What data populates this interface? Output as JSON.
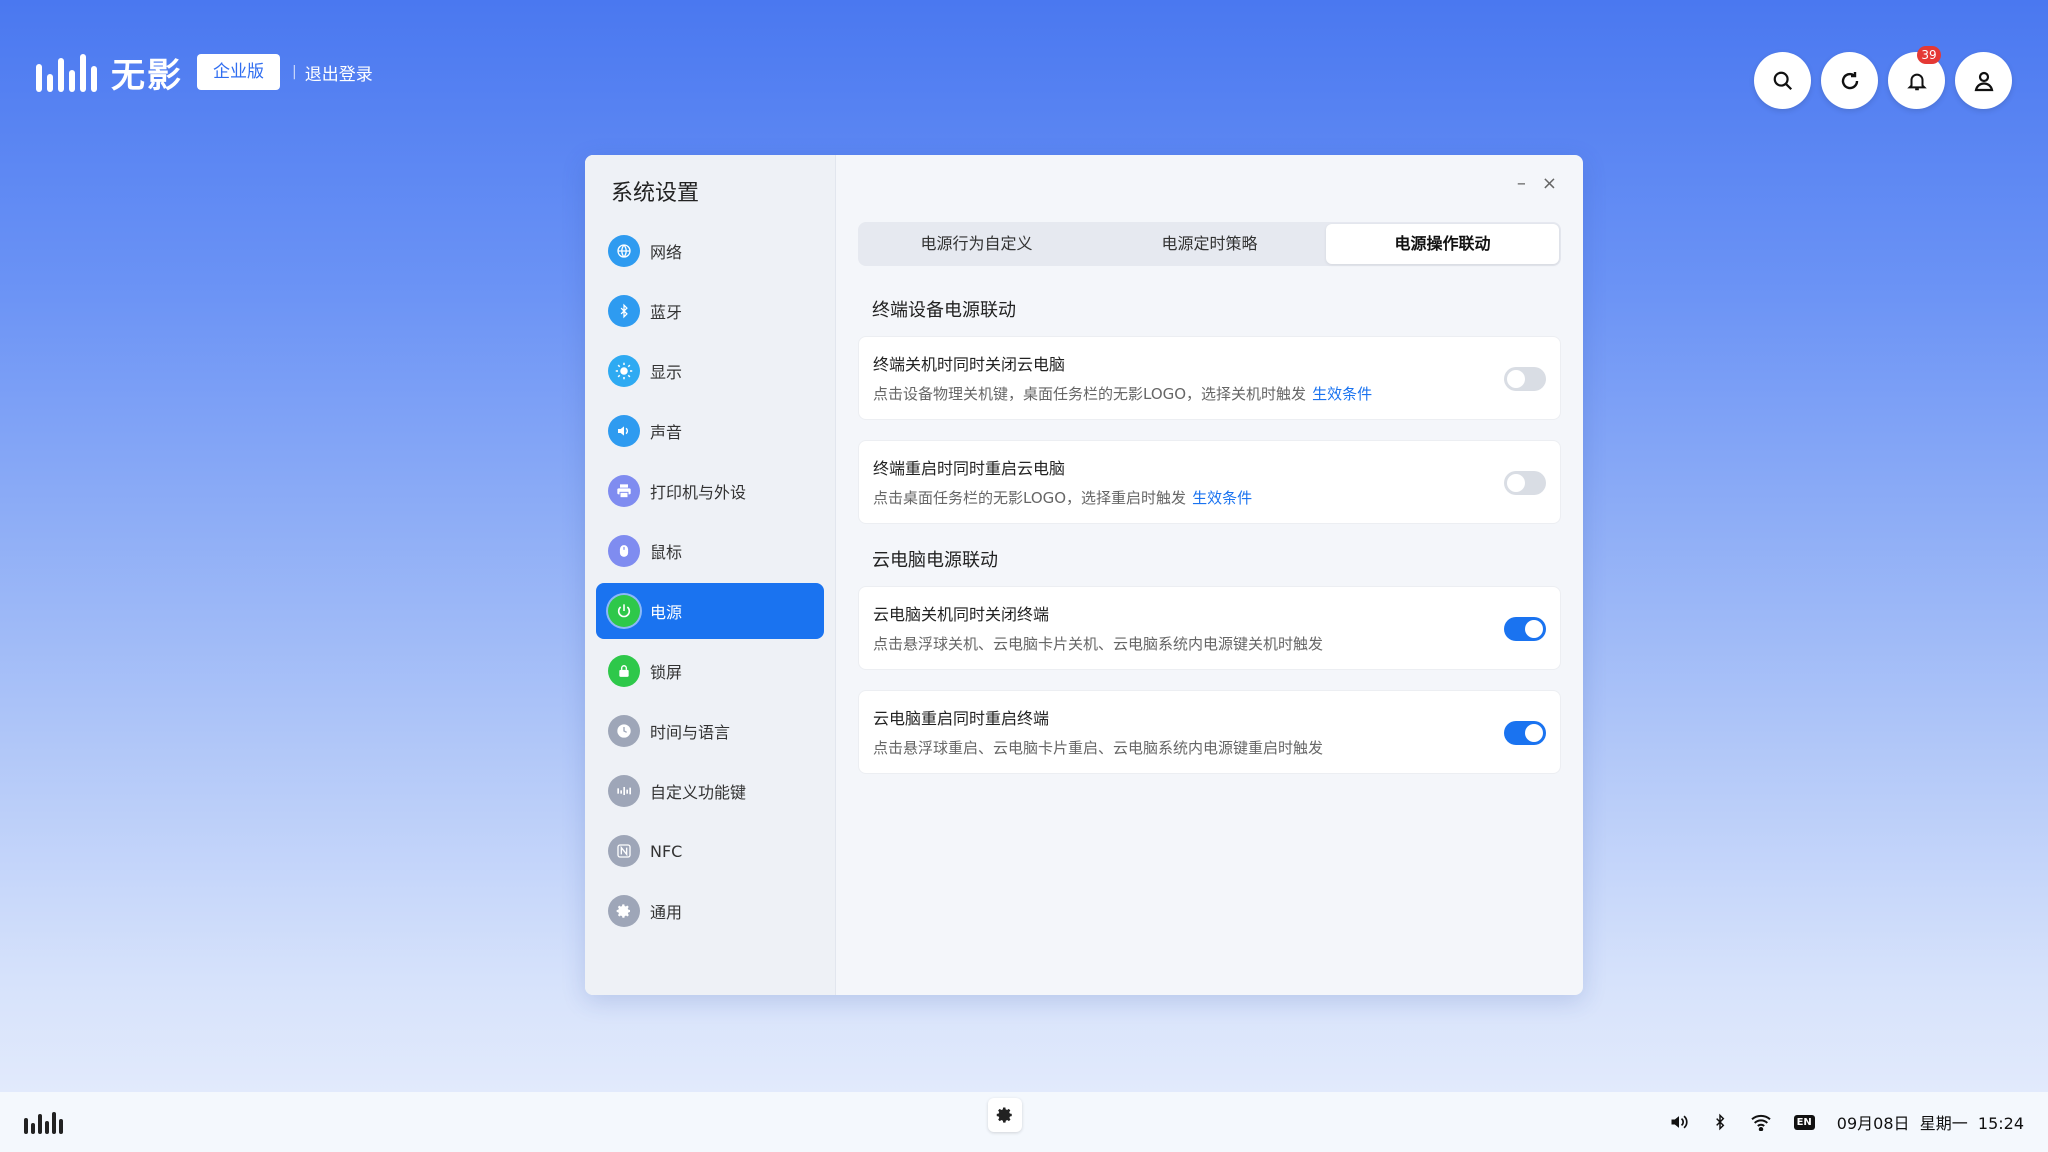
{
  "brand": {
    "name": "无影",
    "edition": "企业版",
    "separator": "|",
    "logout": "退出登录"
  },
  "top_actions": {
    "notification_count": "39"
  },
  "window": {
    "title": "系统设置",
    "controls": {
      "minimize": "–",
      "close": "×"
    }
  },
  "sidebar": {
    "items": [
      {
        "label": "网络",
        "icon": "globe-icon",
        "color": "#2e9bf0"
      },
      {
        "label": "蓝牙",
        "icon": "bluetooth-icon",
        "color": "#2e9bf0"
      },
      {
        "label": "显示",
        "icon": "brightness-icon",
        "color": "#2eaaf2"
      },
      {
        "label": "声音",
        "icon": "speaker-icon",
        "color": "#2e9bf0"
      },
      {
        "label": "打印机与外设",
        "icon": "printer-icon",
        "color": "#7f8cf0"
      },
      {
        "label": "鼠标",
        "icon": "mouse-icon",
        "color": "#7f8cf0"
      },
      {
        "label": "电源",
        "icon": "power-icon",
        "color": "#2ec84a",
        "active": true
      },
      {
        "label": "锁屏",
        "icon": "lock-icon",
        "color": "#2ec84a"
      },
      {
        "label": "时间与语言",
        "icon": "clock-icon",
        "color": "#9ea6b8"
      },
      {
        "label": "自定义功能键",
        "icon": "wuying-key-icon",
        "color": "#9ea6b8"
      },
      {
        "label": "NFC",
        "icon": "nfc-icon",
        "color": "#9ea6b8"
      },
      {
        "label": "通用",
        "icon": "gear-icon",
        "color": "#9ea6b8"
      }
    ]
  },
  "tabs": [
    {
      "label": "电源行为自定义"
    },
    {
      "label": "电源定时策略"
    },
    {
      "label": "电源操作联动",
      "active": true
    }
  ],
  "sections": [
    {
      "title": "终端设备电源联动",
      "cards": [
        {
          "title": "终端关机时同时关闭云电脑",
          "desc": "点击设备物理关机键，桌面任务栏的无影LOGO，选择关机时触发",
          "link": "生效条件",
          "on": false
        },
        {
          "title": "终端重启时同时重启云电脑",
          "desc": "点击桌面任务栏的无影LOGO，选择重启时触发",
          "link": "生效条件",
          "on": false
        }
      ]
    },
    {
      "title": "云电脑电源联动",
      "cards": [
        {
          "title": "云电脑关机同时关闭终端",
          "desc": "点击悬浮球关机、云电脑卡片关机、云电脑系统内电源键关机时触发",
          "on": true
        },
        {
          "title": "云电脑重启同时重启终端",
          "desc": "点击悬浮球重启、云电脑卡片重启、云电脑系统内电源键重启时触发",
          "on": true
        }
      ]
    }
  ],
  "taskbar": {
    "ime": "EN",
    "date": "09月08日",
    "weekday": "星期一",
    "time": "15:24"
  },
  "colors": {
    "accent": "#1a73f0",
    "toggle_off": "#d9dde4"
  }
}
